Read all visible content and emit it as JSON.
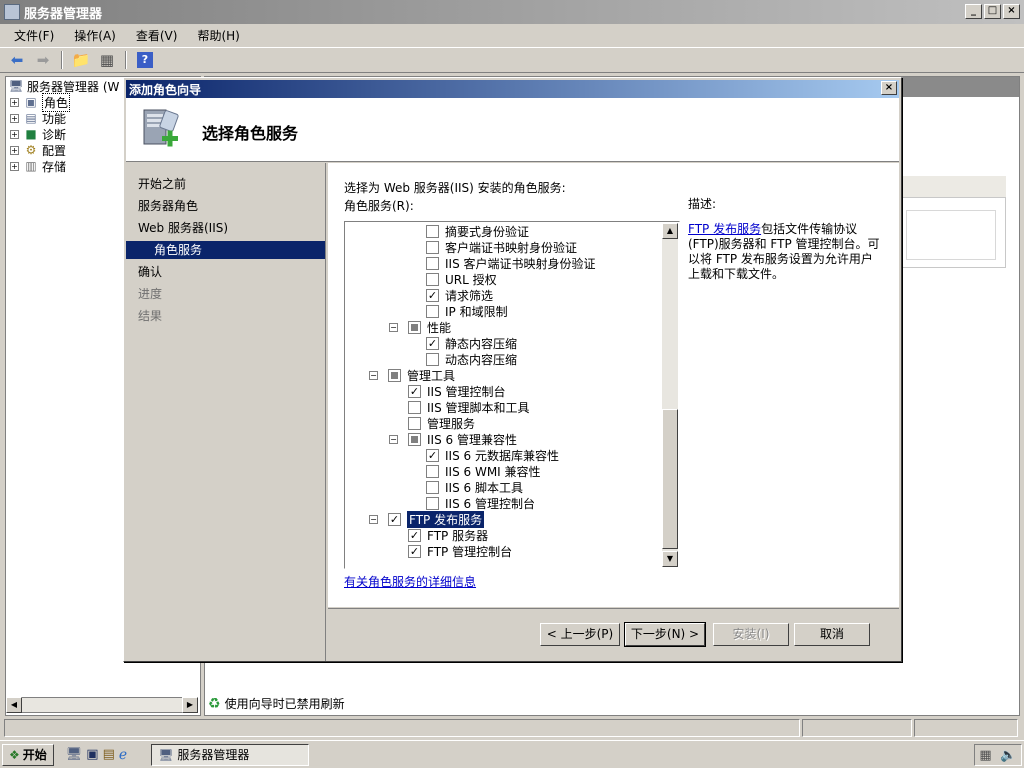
{
  "window": {
    "title": "服务器管理器",
    "min": "_",
    "max": "□",
    "close": "×"
  },
  "menu": [
    {
      "label": "文件(F)"
    },
    {
      "label": "操作(A)"
    },
    {
      "label": "查看(V)"
    },
    {
      "label": "帮助(H)"
    }
  ],
  "tree": {
    "root": "服务器管理器 (W",
    "items": [
      {
        "label": "角色"
      },
      {
        "label": "功能"
      },
      {
        "label": "诊断"
      },
      {
        "label": "配置"
      },
      {
        "label": "存储"
      }
    ]
  },
  "dialog": {
    "title": "添加角色向导",
    "close": "×",
    "header_title": "选择角色服务",
    "nav": [
      {
        "label": "开始之前",
        "state": "normal"
      },
      {
        "label": "服务器角色",
        "state": "normal"
      },
      {
        "label": "Web 服务器(IIS)",
        "state": "normal"
      },
      {
        "label": "角色服务",
        "state": "selected"
      },
      {
        "label": "确认",
        "state": "normal"
      },
      {
        "label": "进度",
        "state": "disabled"
      },
      {
        "label": "结果",
        "state": "disabled"
      }
    ],
    "instruction": "选择为 Web 服务器(IIS) 安装的角色服务:",
    "list_label": "角色服务(R):",
    "services": [
      {
        "label": "摘要式身份验证",
        "checked": false
      },
      {
        "label": "客户端证书映射身份验证",
        "checked": false
      },
      {
        "label": "IIS 客户端证书映射身份验证",
        "checked": false
      },
      {
        "label": "URL 授权",
        "checked": false
      },
      {
        "label": "请求筛选",
        "checked": true
      },
      {
        "label": "IP 和域限制",
        "checked": false
      },
      {
        "label": "性能",
        "checked": "partial",
        "expander": "⊟"
      },
      {
        "label": "静态内容压缩",
        "checked": true
      },
      {
        "label": "动态内容压缩",
        "checked": false
      },
      {
        "label": "管理工具",
        "checked": "partial",
        "expander": "⊟"
      },
      {
        "label": "IIS 管理控制台",
        "checked": true
      },
      {
        "label": "IIS 管理脚本和工具",
        "checked": false
      },
      {
        "label": "管理服务",
        "checked": false
      },
      {
        "label": "IIS 6 管理兼容性",
        "checked": "partial",
        "expander": "⊟"
      },
      {
        "label": "IIS 6 元数据库兼容性",
        "checked": true
      },
      {
        "label": "IIS 6 WMI 兼容性",
        "checked": false
      },
      {
        "label": "IIS 6 脚本工具",
        "checked": false
      },
      {
        "label": "IIS 6 管理控制台",
        "checked": false
      },
      {
        "label": "FTP 发布服务",
        "checked": true,
        "expander": "⊟",
        "selected": true
      },
      {
        "label": "FTP 服务器",
        "checked": true
      },
      {
        "label": "FTP 管理控制台",
        "checked": true
      }
    ],
    "more_info_link": "有关角色服务的详细信息",
    "description": {
      "label": "描述:",
      "link": "FTP 发布服务",
      "text": "包括文件传输协议(FTP)服务器和 FTP 管理控制台。可以将 FTP 发布服务设置为允许用户上载和下载文件。"
    },
    "buttons": {
      "back": "< 上一步(P)",
      "next": "下一步(N) >",
      "install": "安装(I)",
      "cancel": "取消"
    }
  },
  "status": {
    "message": "使用向导时已禁用刷新"
  },
  "taskbar": {
    "start": "开始",
    "task": "服务器管理器"
  }
}
